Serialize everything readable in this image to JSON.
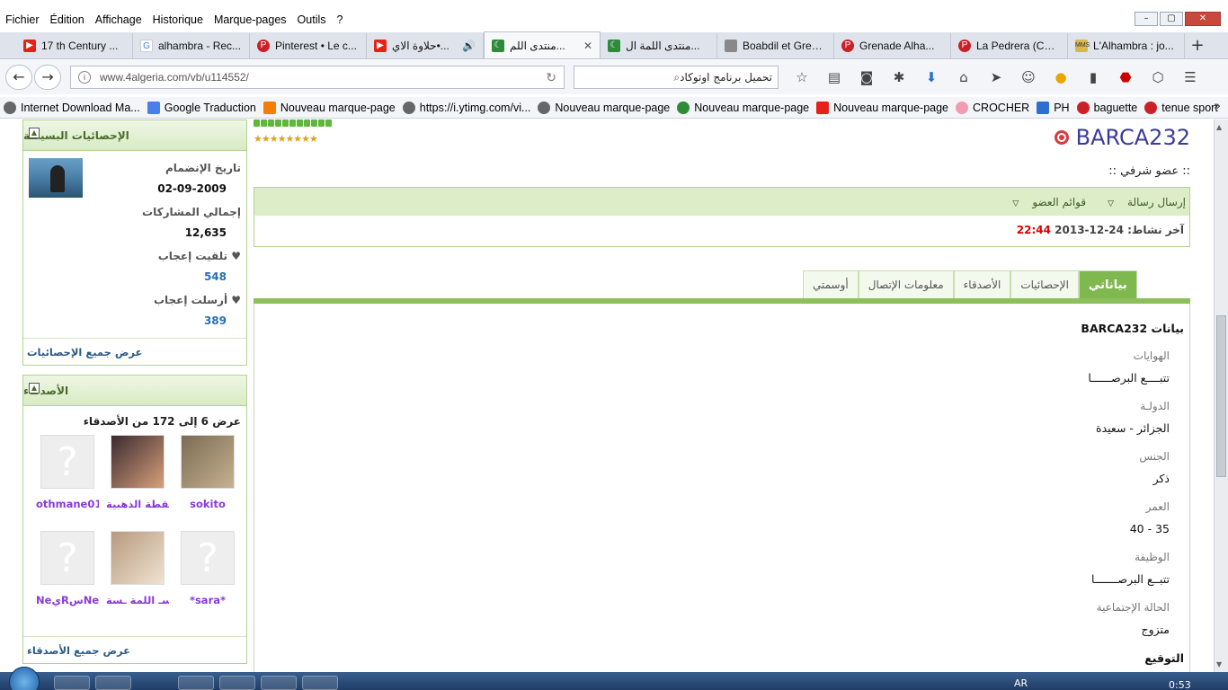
{
  "menu": [
    "Fichier",
    "Édition",
    "Affichage",
    "Historique",
    "Marque-pages",
    "Outils",
    "?"
  ],
  "tabs": [
    {
      "label": "17 th Century ...",
      "icon": "youtube-icon",
      "kind": "yt"
    },
    {
      "label": "alhambra - Rec...",
      "icon": "google-icon",
      "kind": "g"
    },
    {
      "label": "Pinterest • Le c...",
      "icon": "pinterest-icon",
      "kind": "pin"
    },
    {
      "label": "حلاوة الاي•...",
      "icon": "youtube-icon",
      "kind": "yt"
    },
    {
      "label": "منتدى اللم...",
      "icon": "algeria-flag-icon",
      "kind": "dz"
    },
    {
      "label": "منتدى اللمة ال...",
      "icon": "algeria-flag-icon",
      "kind": "dz"
    },
    {
      "label": "Boabdil et Gren...",
      "icon": "page-icon",
      "kind": "gen"
    },
    {
      "label": "Grenade Alha...",
      "icon": "pinterest-icon",
      "kind": "pin"
    },
    {
      "label": "La Pedrera (Cas...",
      "icon": "pinterest-icon",
      "kind": "pin"
    },
    {
      "label": "L'Alhambra : jo...",
      "icon": "mms-icon",
      "kind": "mms"
    }
  ],
  "nav": {
    "url": "www.4algeria.com/vb/u114552/",
    "search": "تحميل برنامج اوتوكاد"
  },
  "bookmarks": [
    {
      "label": "Internet Download Ma...",
      "kind": "gen"
    },
    {
      "label": "Google Traduction",
      "kind": "gt"
    },
    {
      "label": "Nouveau marque-page",
      "kind": "bl"
    },
    {
      "label": "https://i.ytimg.com/vi...",
      "kind": "gen"
    },
    {
      "label": "Nouveau marque-page",
      "kind": "gen"
    },
    {
      "label": "Nouveau marque-page",
      "kind": "dz"
    },
    {
      "label": "Nouveau marque-page",
      "kind": "yt"
    },
    {
      "label": "CROCHER",
      "kind": "ht"
    },
    {
      "label": "PH",
      "kind": "k"
    },
    {
      "label": "baguette",
      "kind": "pin"
    },
    {
      "label": "tenue sport",
      "kind": "pin"
    }
  ],
  "stats_block": {
    "title": "الإحصائيات البسيطة",
    "join_label": "تاريخ الإنضمام",
    "join_value": "02-09-2009",
    "posts_label": "إجمالي المشاركات",
    "posts_value": "12,635",
    "likes_received_label": "تلقيت إعجاب",
    "likes_received_value": "548",
    "likes_sent_label": "أرسلت إعجاب",
    "likes_sent_value": "389",
    "footer": "عرض جميع الإحصائيات"
  },
  "friends_block": {
    "title": "الأصدقاء",
    "count_text": "عرض 6 إلى 172 من الأصدقاء",
    "friends": [
      {
        "name": "sokito",
        "photo": "photo1"
      },
      {
        "name": "القطة الذهبية",
        "photo": "photo2"
      },
      {
        "name": "othmane01",
        "photo": "placeholder"
      },
      {
        "name": "*sara*",
        "photo": "placeholder"
      },
      {
        "name": "برنسـ اللمة ـسة",
        "photo": "photo3"
      },
      {
        "name": "NeيRسNeي",
        "photo": "placeholder"
      }
    ],
    "footer": "عرض جميع الأصدقاء"
  },
  "profile": {
    "username": "BARCA232",
    "user_title": ":: عضو شرفي ::",
    "send_message": "إرسال رسالة",
    "member_lists": "قوائم العضو",
    "last_activity_label": "آخر نشاط:",
    "last_activity_date": "24-12-2013",
    "last_activity_time": "22:44"
  },
  "profile_tabs": [
    "بياناتي",
    "الإحصائيات",
    "الأصدقاء",
    "معلومات الإتصال",
    "أوسمتي"
  ],
  "about": {
    "title": "بيانات BARCA232",
    "fields": [
      {
        "label": "الهوايات",
        "value": "تتبــــع البرصــــــا"
      },
      {
        "label": "الدولـة",
        "value": "الجزائر - سعيدة"
      },
      {
        "label": "الجنس",
        "value": "ذكر"
      },
      {
        "label": "العمر",
        "value": "35 - 40"
      },
      {
        "label": "الوظيفة",
        "value": "تتبــع البرصـــــــا"
      },
      {
        "label": "الحالة الإجتماعية",
        "value": "متزوج"
      }
    ],
    "signature_label": "التوقيع"
  },
  "taskbar": {
    "lang": "AR",
    "clock": "0:53"
  }
}
